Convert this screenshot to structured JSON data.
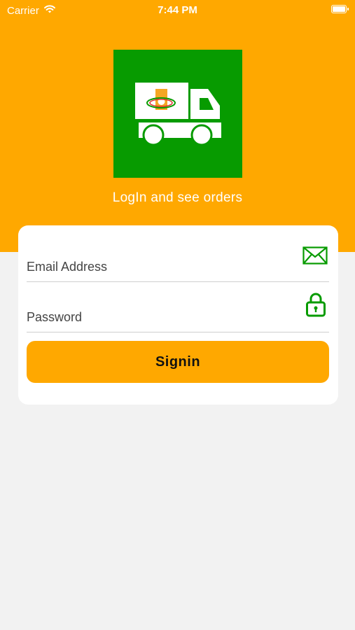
{
  "status_bar": {
    "carrier": "Carrier",
    "time": "7:44 PM"
  },
  "header": {
    "subtitle": "LogIn and see orders"
  },
  "login_form": {
    "email_placeholder": "Email Address",
    "password_placeholder": "Password",
    "signin_label": "Signin"
  },
  "colors": {
    "brand_orange": "#ffa800",
    "brand_green": "#079b00",
    "background": "#f2f2f2"
  },
  "icons": [
    "wifi-icon",
    "battery-icon",
    "delivery-truck-logo-icon",
    "envelope-icon",
    "lock-icon"
  ]
}
